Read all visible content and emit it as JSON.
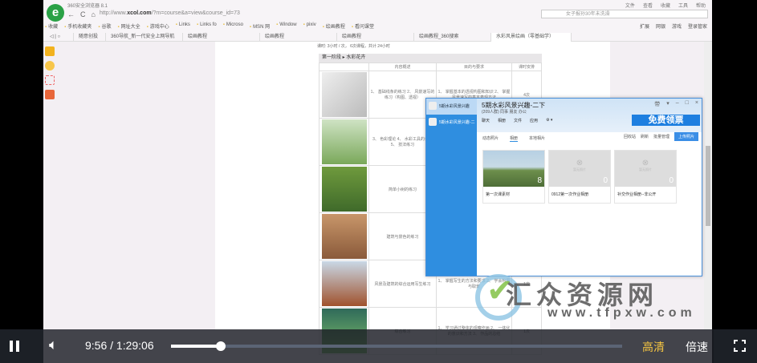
{
  "browser": {
    "title": "360安全浏览器 8.1",
    "url_prefix": "http://www.",
    "url_domain": "xcol.com",
    "url_path": "/?m=course&a=view&course_id=73",
    "search_placeholder": "女子报孙30年未洗澡",
    "right_tools": [
      "文件",
      "查看",
      "收藏",
      "工具",
      "帮助"
    ],
    "bookmarks": [
      "收藏",
      "手机收藏夹",
      "谷歌",
      "网址大全",
      "游戏中心",
      "Links",
      "Links fo",
      "Microso",
      "MSN 网",
      "Window",
      "pixiv",
      "绘画教程",
      "看问课堂"
    ],
    "right_bookmarks": [
      "扩展",
      "网银",
      "游戏",
      "登录管家"
    ],
    "tabs": [
      "随意创投",
      "360导航_新一代安全上网导航",
      "绘画教程",
      "绘画教程",
      "绘画教程",
      "绘画教程_360搜索",
      "水彩风景绘画（零基础学）"
    ],
    "active_tab": 6
  },
  "document": {
    "meta": "课时: 3小时 / 次， 6次课程，共计 24小时",
    "stage": "第一阶段",
    "stage_title": "水彩花卉",
    "headers": [
      "",
      "内容概述",
      "目的与要求",
      "课时安排"
    ],
    "rows": [
      {
        "content": "1、 基础线条的练习 2、 风景速写的练习（构图、透视）",
        "goal": "1、 掌握基本的透视构图和知识 2、 掌握风景速写的基本表现方法",
        "hours": "4次"
      },
      {
        "content": "3、 色彩理论 4、 水彩工具的介绍 5、 技法练习",
        "goal": "",
        "hours": ""
      },
      {
        "content": "简单小树的练习",
        "goal": "",
        "hours": ""
      },
      {
        "content": "建筑与景色的练习",
        "goal": "",
        "hours": ""
      },
      {
        "content": "风景及建筑的综合运用写生练习",
        "goal": "1、 掌握写生的方法和要求 2、 学会构图与取景",
        "hours": "1次"
      },
      {
        "content": "综合练习",
        "goal": "1、 学习通过整体的观察作画 2、 一体化的意识和方法 3、 作品的总结",
        "hours": "1次"
      }
    ]
  },
  "qq": {
    "groups": [
      "5期水彩风景兴趣",
      "5期水彩风景兴趣-二"
    ],
    "name": "5期水彩风景兴趣-二下",
    "sub": "(209人群) 同事 朋友 办公",
    "controls": [
      "带",
      " ▾",
      "–",
      "□",
      "×"
    ],
    "tools": [
      "聊天",
      "相册",
      "文件",
      "应用",
      "⚙ ▾"
    ],
    "ad": "免费领票",
    "subtabs": [
      "动态照片",
      "相册",
      "本地相片"
    ],
    "actions": [
      "回收站",
      "刷新",
      "批量管理"
    ],
    "upload": "上传照片",
    "albums": [
      {
        "label": "第一次课素材",
        "count": "8"
      },
      {
        "label": "0912第一次作业相册",
        "count": "0",
        "empty": "暂无照片"
      },
      {
        "label": "补交作业相册--非公开",
        "count": "0",
        "empty": "暂无照片"
      }
    ]
  },
  "watermark": {
    "cn": "汇众资源网",
    "url": "www.tfpxw.com"
  },
  "player": {
    "current": "9:56",
    "separator": "/",
    "duration": "1:29:06",
    "progress": 0.111,
    "quality": "高清",
    "speed": "倍速"
  }
}
